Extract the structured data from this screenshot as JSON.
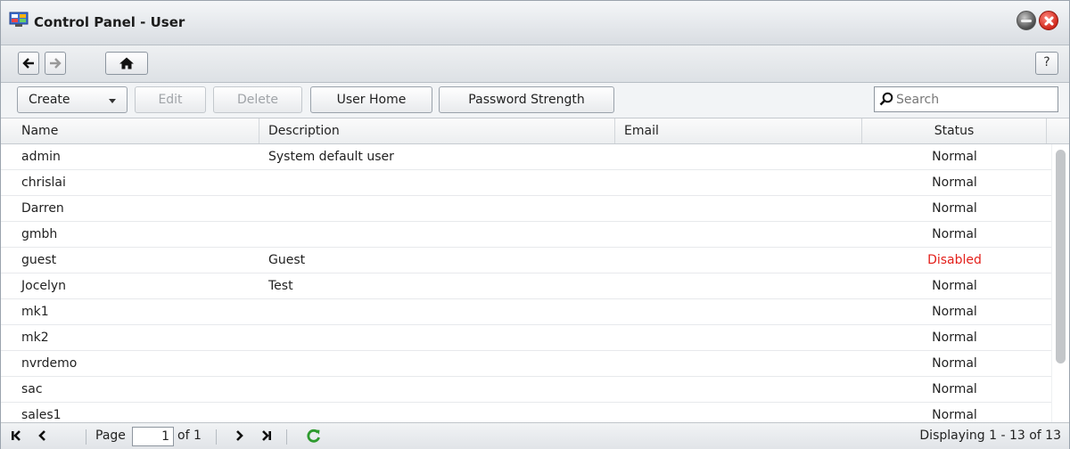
{
  "window": {
    "title": "Control Panel - User"
  },
  "nav": {
    "back_icon": "arrow-left-icon",
    "forward_icon": "arrow-right-icon",
    "home_icon": "home-icon",
    "help_label": "?"
  },
  "toolbar": {
    "create_label": "Create",
    "edit_label": "Edit",
    "delete_label": "Delete",
    "user_home_label": "User Home",
    "password_strength_label": "Password Strength",
    "search_placeholder": "Search"
  },
  "table": {
    "columns": [
      "Name",
      "Description",
      "Email",
      "Status"
    ],
    "rows": [
      {
        "name": "admin",
        "description": "System default user",
        "email": "",
        "status": "Normal"
      },
      {
        "name": "chrislai",
        "description": "",
        "email": "",
        "status": "Normal"
      },
      {
        "name": "Darren",
        "description": "",
        "email": "",
        "status": "Normal"
      },
      {
        "name": "gmbh",
        "description": "",
        "email": "",
        "status": "Normal"
      },
      {
        "name": "guest",
        "description": "Guest",
        "email": "",
        "status": "Disabled"
      },
      {
        "name": "Jocelyn",
        "description": "Test",
        "email": "",
        "status": "Normal"
      },
      {
        "name": "mk1",
        "description": "",
        "email": "",
        "status": "Normal"
      },
      {
        "name": "mk2",
        "description": "",
        "email": "",
        "status": "Normal"
      },
      {
        "name": "nvrdemo",
        "description": "",
        "email": "",
        "status": "Normal"
      },
      {
        "name": "sac",
        "description": "",
        "email": "",
        "status": "Normal"
      },
      {
        "name": "sales1",
        "description": "",
        "email": "",
        "status": "Normal"
      }
    ]
  },
  "paging": {
    "page_label": "Page",
    "page_value": "1",
    "of_label": "of 1",
    "display_text": "Displaying 1 - 13 of 13"
  },
  "colors": {
    "disabled_status": "#e3201b",
    "refresh_icon": "#2e9a2e"
  }
}
